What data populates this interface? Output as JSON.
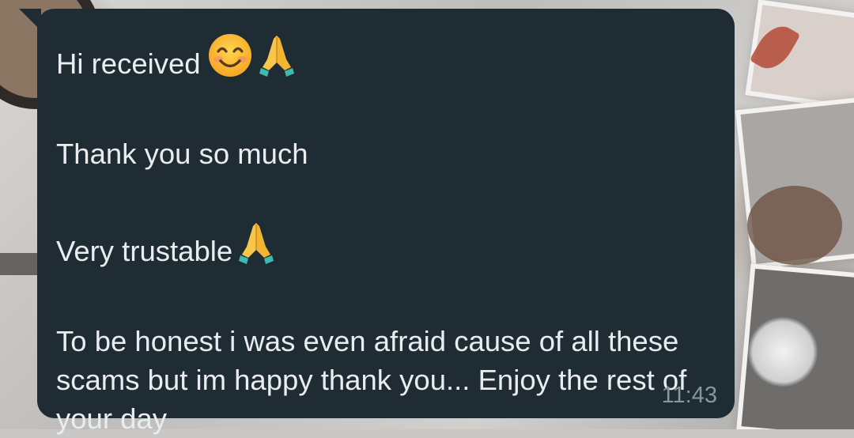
{
  "message": {
    "line1": "Hi received",
    "line1_emojis": [
      "smiling-face-icon",
      "folded-hands-icon"
    ],
    "line2": "Thank you so much",
    "line3": "Very trustable",
    "line3_emojis": [
      "folded-hands-icon"
    ],
    "line4": "To be honest i was even afraid cause of all these scams but im happy thank you... Enjoy the rest of your day",
    "timestamp": "11:43"
  },
  "colors": {
    "bubble": "#202c33",
    "text": "#e9edef",
    "timestamp": "#8696a0"
  }
}
